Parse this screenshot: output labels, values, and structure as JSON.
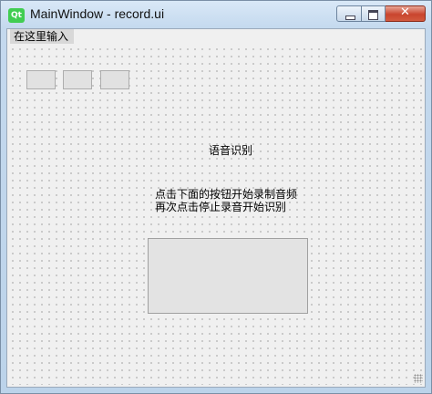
{
  "window": {
    "logo_text": "Qt",
    "title": "MainWindow - record.ui"
  },
  "menubar": {
    "items": [
      {
        "label": "在这里输入"
      }
    ]
  },
  "form": {
    "heading": "语音识别",
    "instruction_line1": "点击下面的按钮开始录制音频",
    "instruction_line2": "再次点击停止录音开始识别"
  }
}
